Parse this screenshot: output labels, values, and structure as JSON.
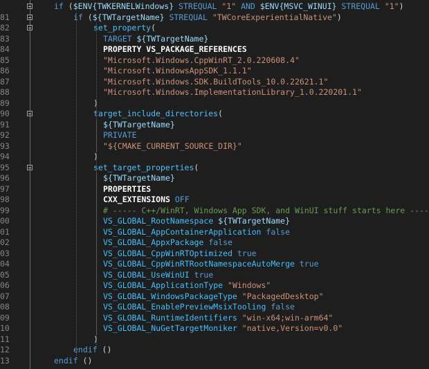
{
  "lines": [
    {
      "n": "",
      "indent": 0,
      "fold": true,
      "tokens": [
        {
          "c": "kw",
          "t": "if"
        },
        {
          "c": "plain",
          "t": " ("
        },
        {
          "c": "var",
          "t": "$ENV{TWKERNELWindows}"
        },
        {
          "c": "kw",
          "t": " STREQUAL "
        },
        {
          "c": "str",
          "t": "\"1\""
        },
        {
          "c": "kw",
          "t": " AND "
        },
        {
          "c": "var",
          "t": "$ENV{MSVC_WINUI}"
        },
        {
          "c": "kw",
          "t": " STREQUAL "
        },
        {
          "c": "str",
          "t": "\"1\""
        },
        {
          "c": "plain",
          "t": ")"
        }
      ]
    },
    {
      "n": "81",
      "indent": 1,
      "fold": true,
      "tokens": [
        {
          "c": "kw",
          "t": "if"
        },
        {
          "c": "plain",
          "t": " ("
        },
        {
          "c": "var",
          "t": "${TWTargetName}"
        },
        {
          "c": "kw",
          "t": " STREQUAL "
        },
        {
          "c": "str",
          "t": "\"TWCoreExperientialNative\""
        },
        {
          "c": "plain",
          "t": ")"
        }
      ]
    },
    {
      "n": "82",
      "indent": 2,
      "fold": true,
      "tokens": [
        {
          "c": "fn",
          "t": "set_property"
        },
        {
          "c": "plain",
          "t": "("
        }
      ]
    },
    {
      "n": "83",
      "indent": 3,
      "fold": false,
      "tokens": [
        {
          "c": "kw",
          "t": "TARGET "
        },
        {
          "c": "var",
          "t": "${TWTargetName}"
        }
      ]
    },
    {
      "n": "84",
      "indent": 3,
      "fold": false,
      "tokens": [
        {
          "c": "bold",
          "t": "PROPERTY VS_PACKAGE_REFERENCES"
        }
      ]
    },
    {
      "n": "85",
      "indent": 3,
      "fold": false,
      "tokens": [
        {
          "c": "str",
          "t": "\"Microsoft.Windows.CppWinRT_2.0.220608.4\""
        }
      ]
    },
    {
      "n": "86",
      "indent": 3,
      "fold": false,
      "tokens": [
        {
          "c": "str",
          "t": "\"Microsoft.WindowsAppSDK_1.1.1\""
        }
      ]
    },
    {
      "n": "87",
      "indent": 3,
      "fold": false,
      "tokens": [
        {
          "c": "str",
          "t": "\"Microsoft.Windows.SDK.BuildTools_10.0.22621.1\""
        }
      ]
    },
    {
      "n": "88",
      "indent": 3,
      "fold": false,
      "tokens": [
        {
          "c": "str",
          "t": "\"Microsoft.Windows.ImplementationLibrary_1.0.220201.1\""
        }
      ]
    },
    {
      "n": "89",
      "indent": 2,
      "fold": false,
      "tokens": [
        {
          "c": "plain",
          "t": ")"
        }
      ]
    },
    {
      "n": "90",
      "indent": 2,
      "fold": true,
      "tokens": [
        {
          "c": "fn",
          "t": "target_include_directories"
        },
        {
          "c": "plain",
          "t": "("
        }
      ]
    },
    {
      "n": "91",
      "indent": 3,
      "fold": false,
      "tokens": [
        {
          "c": "var",
          "t": "${TWTargetName}"
        }
      ]
    },
    {
      "n": "92",
      "indent": 3,
      "fold": false,
      "tokens": [
        {
          "c": "kw",
          "t": "PRIVATE"
        }
      ]
    },
    {
      "n": "93",
      "indent": 3,
      "fold": false,
      "tokens": [
        {
          "c": "str",
          "t": "\"${CMAKE_CURRENT_SOURCE_DIR}\""
        }
      ]
    },
    {
      "n": "94",
      "indent": 2,
      "fold": false,
      "tokens": [
        {
          "c": "plain",
          "t": ")"
        }
      ]
    },
    {
      "n": "95",
      "indent": 2,
      "fold": true,
      "tokens": [
        {
          "c": "fn",
          "t": "set_target_properties"
        },
        {
          "c": "plain",
          "t": "("
        }
      ]
    },
    {
      "n": "96",
      "indent": 3,
      "fold": false,
      "tokens": [
        {
          "c": "var",
          "t": "${TWTargetName}"
        }
      ]
    },
    {
      "n": "97",
      "indent": 3,
      "fold": false,
      "tokens": [
        {
          "c": "bold",
          "t": "PROPERTIES"
        }
      ]
    },
    {
      "n": "98",
      "indent": 3,
      "fold": false,
      "tokens": [
        {
          "c": "bold",
          "t": "CXX_EXTENSIONS"
        },
        {
          "c": "kw",
          "t": " OFF"
        }
      ]
    },
    {
      "n": "99",
      "indent": 3,
      "fold": false,
      "tokens": [
        {
          "c": "cm",
          "t": "# ----- C++/WinRT, Windows App SDK, and WinUI stuff starts here -----"
        }
      ]
    },
    {
      "n": "00",
      "indent": 3,
      "fold": false,
      "tokens": [
        {
          "c": "vsv",
          "t": "VS_GLOBAL_RootNamespace "
        },
        {
          "c": "var",
          "t": "${TWTargetName}"
        }
      ]
    },
    {
      "n": "01",
      "indent": 3,
      "fold": false,
      "tokens": [
        {
          "c": "vsv",
          "t": "VS_GLOBAL_AppContainerApplication "
        },
        {
          "c": "kw",
          "t": "false"
        }
      ]
    },
    {
      "n": "02",
      "indent": 3,
      "fold": false,
      "tokens": [
        {
          "c": "vsv",
          "t": "VS_GLOBAL_AppxPackage "
        },
        {
          "c": "kw",
          "t": "false"
        }
      ]
    },
    {
      "n": "03",
      "indent": 3,
      "fold": false,
      "tokens": [
        {
          "c": "vsv",
          "t": "VS_GLOBAL_CppWinRTOptimized "
        },
        {
          "c": "kw",
          "t": "true"
        }
      ]
    },
    {
      "n": "04",
      "indent": 3,
      "fold": false,
      "tokens": [
        {
          "c": "vsv",
          "t": "VS_GLOBAL_CppWinRTRootNamespaceAutoMerge "
        },
        {
          "c": "kw",
          "t": "true"
        }
      ]
    },
    {
      "n": "05",
      "indent": 3,
      "fold": false,
      "tokens": [
        {
          "c": "vsv",
          "t": "VS_GLOBAL_UseWinUI "
        },
        {
          "c": "kw",
          "t": "true"
        }
      ]
    },
    {
      "n": "06",
      "indent": 3,
      "fold": false,
      "tokens": [
        {
          "c": "vsv",
          "t": "VS_GLOBAL_ApplicationType "
        },
        {
          "c": "str",
          "t": "\"Windows\""
        }
      ]
    },
    {
      "n": "07",
      "indent": 3,
      "fold": false,
      "tokens": [
        {
          "c": "vsv",
          "t": "VS_GLOBAL_WindowsPackageType "
        },
        {
          "c": "str",
          "t": "\"PackagedDesktop\""
        }
      ]
    },
    {
      "n": "08",
      "indent": 3,
      "fold": false,
      "tokens": [
        {
          "c": "vsv",
          "t": "VS_GLOBAL_EnablePreviewMsixTooling "
        },
        {
          "c": "kw",
          "t": "false"
        }
      ]
    },
    {
      "n": "09",
      "indent": 3,
      "fold": false,
      "tokens": [
        {
          "c": "vsv",
          "t": "VS_GLOBAL_RuntimeIdentifiers "
        },
        {
          "c": "str",
          "t": "\"win-x64;win-arm64\""
        }
      ]
    },
    {
      "n": "10",
      "indent": 3,
      "fold": false,
      "tokens": [
        {
          "c": "vsv",
          "t": "VS_GLOBAL_NuGetTargetMoniker "
        },
        {
          "c": "str",
          "t": "\"native,Version=v0.0\""
        }
      ]
    },
    {
      "n": "11",
      "indent": 2,
      "fold": false,
      "tokens": [
        {
          "c": "plain",
          "t": ")"
        }
      ]
    },
    {
      "n": "12",
      "indent": 1,
      "fold": false,
      "tokens": [
        {
          "c": "kw",
          "t": "endif"
        },
        {
          "c": "plain",
          "t": " ()"
        }
      ]
    },
    {
      "n": "13",
      "indent": 0,
      "fold": false,
      "tokens": [
        {
          "c": "kw",
          "t": "endif"
        },
        {
          "c": "plain",
          "t": " ()"
        }
      ]
    }
  ],
  "colors": {
    "background": "#1e1e1e",
    "keyword": "#569cd6",
    "function": "#4fc1ff",
    "variable": "#9cdcfe",
    "string": "#ce9178",
    "comment": "#6a9955",
    "line_number": "#858585"
  },
  "icons": {
    "fold": "fold-collapse-icon"
  }
}
